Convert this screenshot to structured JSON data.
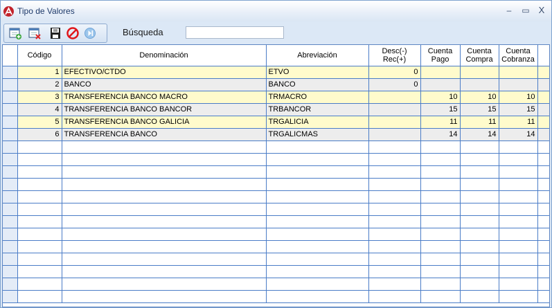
{
  "window": {
    "title": "Tipo de Valores",
    "controls": {
      "minimize": "–",
      "maximize": "▭",
      "close": "X"
    }
  },
  "toolbar": {
    "buttons": [
      {
        "name": "add-record-icon"
      },
      {
        "name": "delete-record-icon"
      },
      {
        "name": "save-icon"
      },
      {
        "name": "cancel-icon"
      },
      {
        "name": "next-icon"
      }
    ],
    "search_label": "Búsqueda",
    "search_value": ""
  },
  "grid": {
    "columns": [
      "Código",
      "Denominación",
      "Abreviación",
      "Desc(-)\nRec(+)",
      "Cuenta\nPago",
      "Cuenta\nCompra",
      "Cuenta\nCobranza"
    ],
    "rows": [
      {
        "codigo": "1",
        "denominacion": "EFECTIVO/CTDO",
        "abreviacion": "ETVO",
        "desc_rec": "0",
        "cuenta_pago": "",
        "cuenta_compra": "",
        "cuenta_cobranza": ""
      },
      {
        "codigo": "2",
        "denominacion": "BANCO",
        "abreviacion": "BANCO",
        "desc_rec": "0",
        "cuenta_pago": "",
        "cuenta_compra": "",
        "cuenta_cobranza": ""
      },
      {
        "codigo": "3",
        "denominacion": "TRANSFERENCIA BANCO MACRO",
        "abreviacion": "TRMACRO",
        "desc_rec": "",
        "cuenta_pago": "10",
        "cuenta_compra": "10",
        "cuenta_cobranza": "10"
      },
      {
        "codigo": "4",
        "denominacion": "TRANSFERENCIA BANCO BANCOR",
        "abreviacion": "TRBANCOR",
        "desc_rec": "",
        "cuenta_pago": "15",
        "cuenta_compra": "15",
        "cuenta_cobranza": "15"
      },
      {
        "codigo": "5",
        "denominacion": "TRANSFERENCIA BANCO GALICIA",
        "abreviacion": "TRGALICIA",
        "desc_rec": "",
        "cuenta_pago": "11",
        "cuenta_compra": "11",
        "cuenta_cobranza": "11"
      },
      {
        "codigo": "6",
        "denominacion": "TRANSFERENCIA BANCO",
        "abreviacion": "TRGALICMAS",
        "desc_rec": "",
        "cuenta_pago": "14",
        "cuenta_compra": "14",
        "cuenta_cobranza": "14"
      }
    ],
    "empty_rows": 13
  },
  "colors": {
    "odd_row": "#fffbcc",
    "even_row": "#ededed",
    "grid_line": "#4a7cc7",
    "window_bg": "#dce8f6"
  }
}
